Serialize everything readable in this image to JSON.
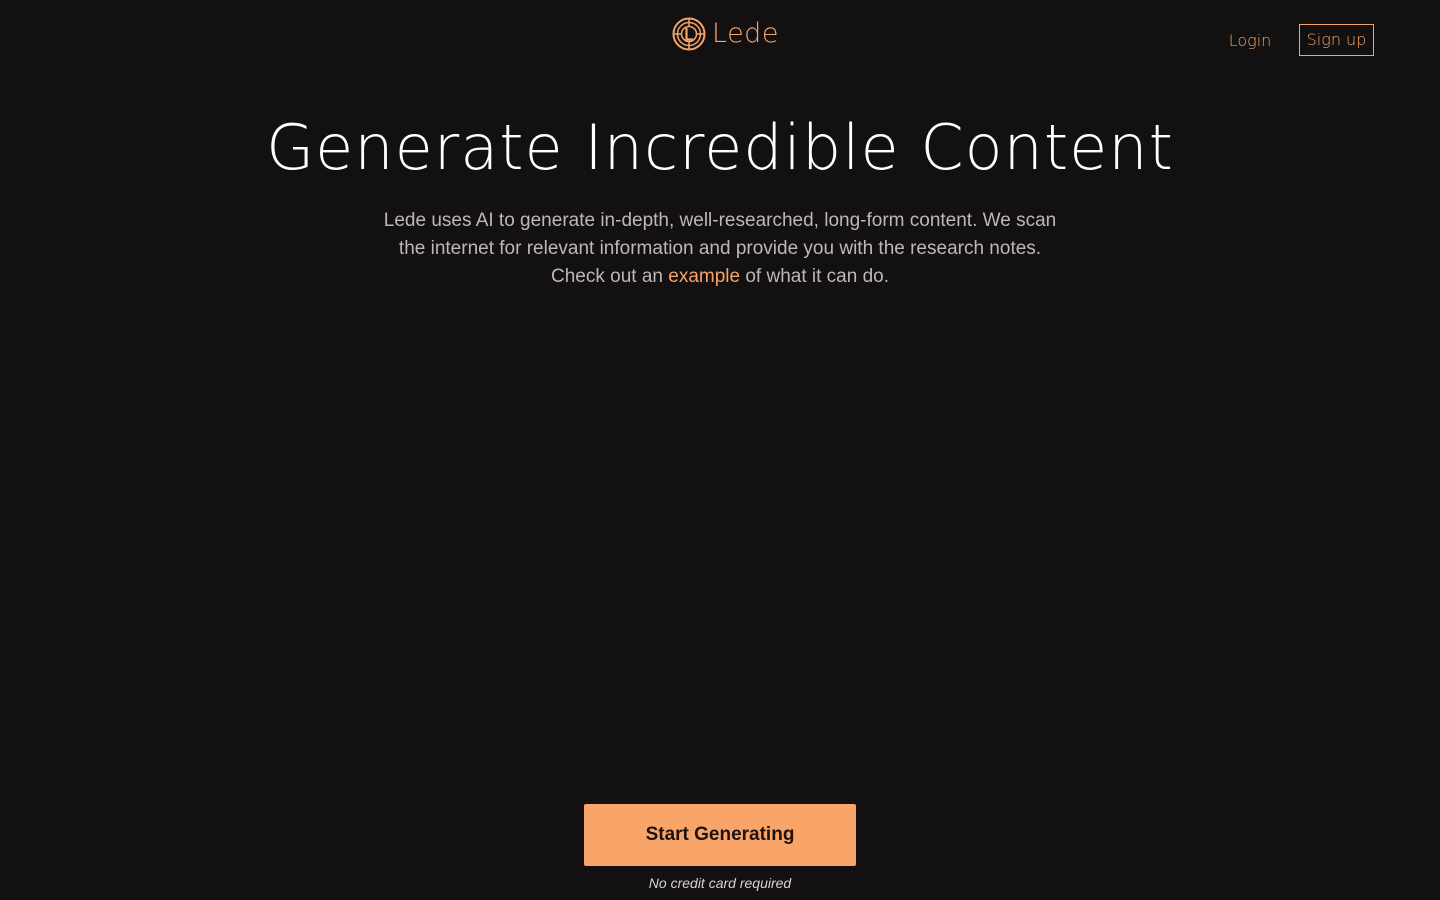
{
  "header": {
    "brand_name": "Lede",
    "logo_icon": "lede-emblem-icon",
    "login_label": "Login",
    "signup_label": "Sign up"
  },
  "hero": {
    "title": "Generate Incredible Content",
    "description_part1": "Lede uses AI to generate in-depth, well-researched, long-form content. We scan the internet for relevant information and provide you with the research notes. Check out an ",
    "description_link": "example",
    "description_part2": " of what it can do."
  },
  "cta": {
    "button_label": "Start Generating",
    "note": "No credit card required"
  },
  "colors": {
    "background": "#121010",
    "accent": "#f6a46a",
    "button_background": "#f9a56a",
    "title_text": "#ffffff",
    "body_text": "#bdb8b4"
  }
}
